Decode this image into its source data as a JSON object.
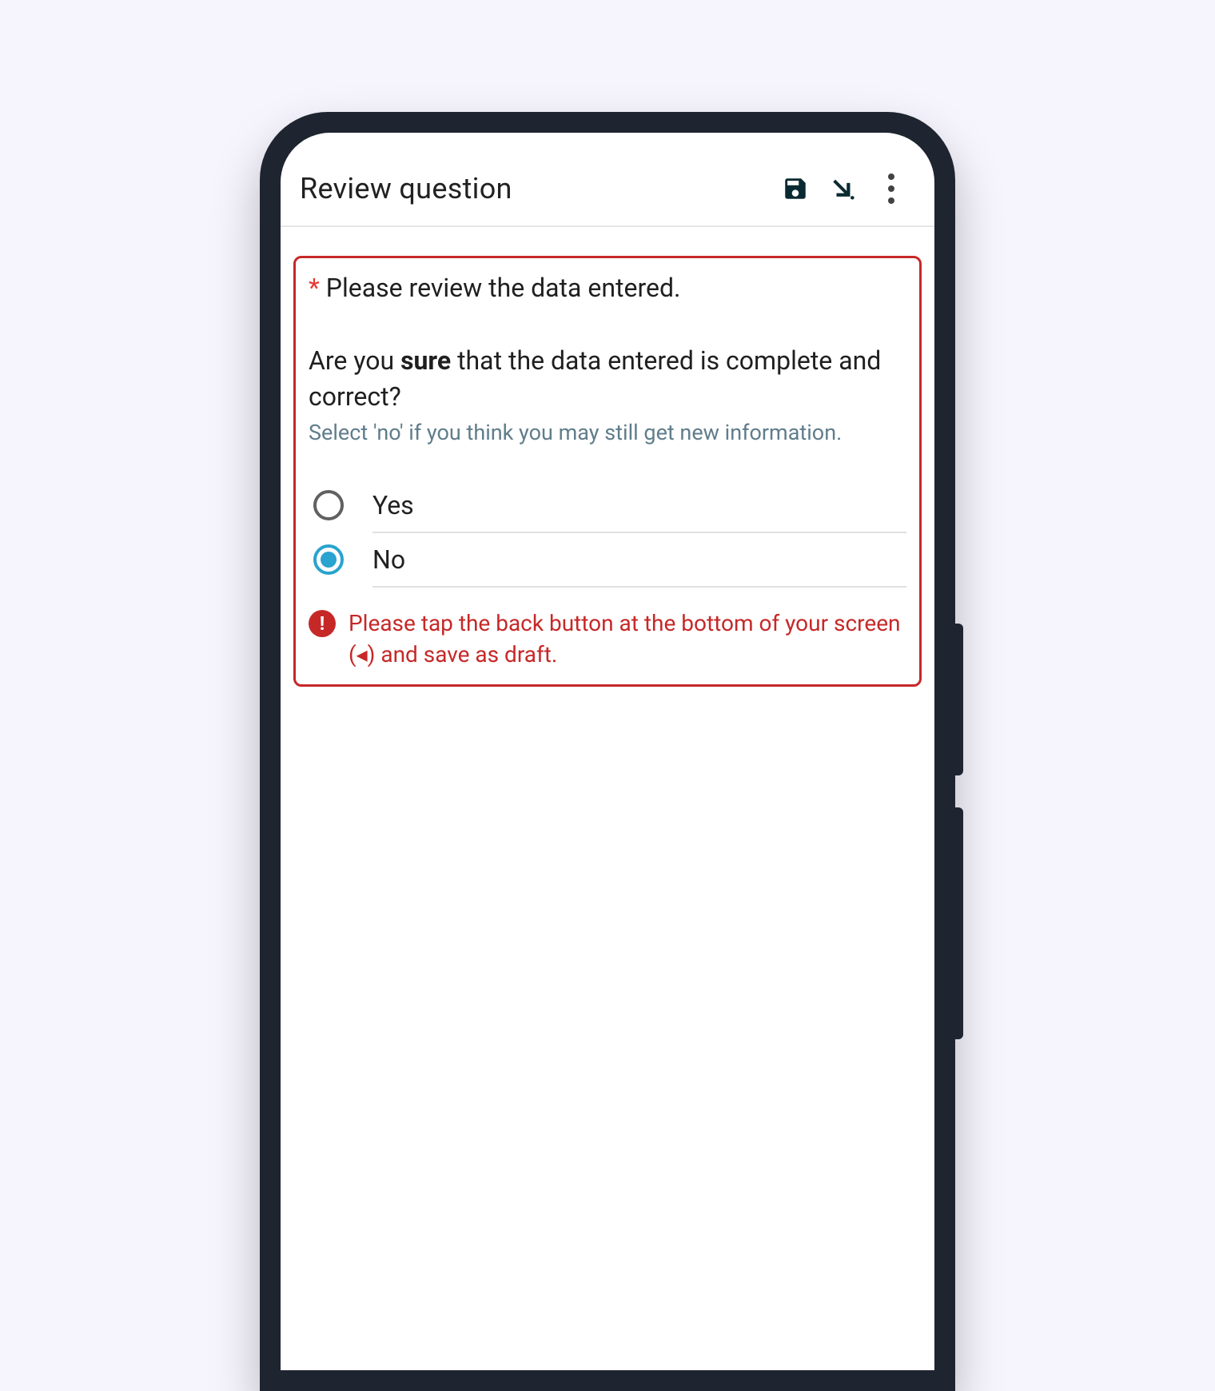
{
  "appbar": {
    "title": "Review question"
  },
  "question": {
    "required_mark": "*",
    "prompt_intro": "Please review the data entered.",
    "prompt_main_pre": "Are you ",
    "prompt_main_bold": "sure",
    "prompt_main_post": " that the data entered is complete and correct?",
    "hint": "Select 'no' if you think you may still get new information.",
    "options": {
      "opt1": "Yes",
      "opt2": "No"
    },
    "selected": "opt2",
    "error": "Please tap the back button at the bottom of your screen (◂) and save as draft."
  }
}
